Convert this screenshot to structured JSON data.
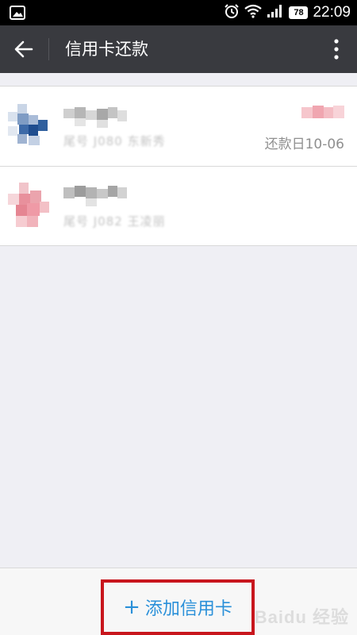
{
  "status_bar": {
    "battery": "78",
    "time": "22:09"
  },
  "app_bar": {
    "title": "信用卡还款"
  },
  "cards": [
    {
      "tail_text": "尾号 J080 东新秀",
      "repay_date": "还款日10-06"
    },
    {
      "tail_text": "尾号 J082 王凌丽",
      "repay_date": ""
    }
  ],
  "bottom": {
    "add_card_label": "添加信用卡",
    "plus": "+"
  },
  "watermark": {
    "text": "Baidu 经验"
  },
  "colors": {
    "status_bar": "#000000",
    "app_bar": "#393a3f",
    "background": "#efeff4",
    "accent_blue": "#2a90d9",
    "highlight_red": "#c8161d"
  }
}
